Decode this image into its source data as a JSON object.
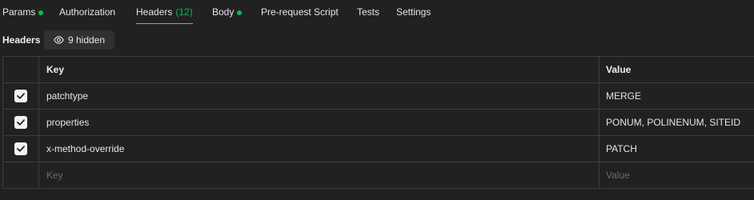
{
  "tabs": [
    {
      "label": "Params",
      "dot": true
    },
    {
      "label": "Authorization",
      "dot": false
    },
    {
      "label": "Headers",
      "count": "(12)",
      "active": true
    },
    {
      "label": "Body",
      "dot": true
    },
    {
      "label": "Pre-request Script",
      "dot": false
    },
    {
      "label": "Tests",
      "dot": false
    },
    {
      "label": "Settings",
      "dot": false
    }
  ],
  "colors": {
    "dot": "#0cbb52",
    "count": "#0cbb52",
    "background": "#212121"
  },
  "headers_section": {
    "title": "Headers",
    "hidden_label": "9 hidden",
    "hidden_icon": "eye-icon"
  },
  "table": {
    "columns": {
      "key": "Key",
      "value": "Value"
    },
    "rows": [
      {
        "checked": true,
        "key": "patchtype",
        "value": "MERGE"
      },
      {
        "checked": true,
        "key": "properties",
        "value": "PONUM, POLINENUM, SITEID"
      },
      {
        "checked": true,
        "key": "x-method-override",
        "value": "PATCH"
      }
    ],
    "new_row": {
      "key_placeholder": "Key",
      "value_placeholder": "Value"
    }
  }
}
